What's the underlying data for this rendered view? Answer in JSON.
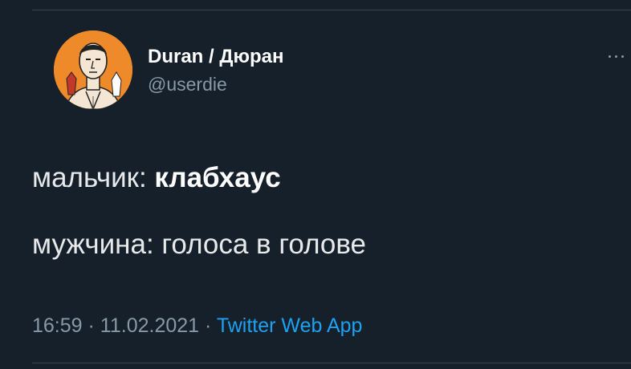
{
  "tweet": {
    "author": {
      "display_name": "Duran / Дюран",
      "handle": "@userdie"
    },
    "more_icon": "more-horizontal-icon",
    "lines": [
      {
        "normal": "мальчик: ",
        "bold": "клабхаус"
      },
      {
        "normal": "мужчина: голоса в голове"
      }
    ],
    "meta": {
      "time": "16:59",
      "separator": "·",
      "date": "11.02.2021",
      "app": "Twitter Web App"
    },
    "colors": {
      "background": "#15202b",
      "text": "#e7e9ea",
      "secondary": "#8899a6",
      "accent": "#1da1f2",
      "avatar_background": "#ef8a2b"
    }
  }
}
